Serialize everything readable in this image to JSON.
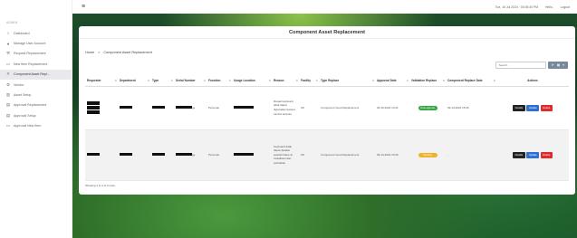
{
  "sidebar": {
    "header": "ADMIN",
    "items": [
      {
        "label": "Dashboard",
        "icon": "home-icon"
      },
      {
        "label": "Manage User Account",
        "icon": "user-icon"
      },
      {
        "label": "Request Replacement",
        "icon": "wrench-icon"
      },
      {
        "label": "New Item Replacement",
        "icon": "document-icon"
      },
      {
        "label": "Component Asset Repl...",
        "icon": "cross-arrows-icon"
      },
      {
        "label": "Vendor",
        "icon": "gear-icon"
      },
      {
        "label": "Asset Setup",
        "icon": "trash-icon"
      },
      {
        "label": "Approval Replacement",
        "icon": "calendar-icon"
      },
      {
        "label": "Approval Setup",
        "icon": "calendar-icon"
      },
      {
        "label": "Approval New Item",
        "icon": "document-icon"
      }
    ]
  },
  "topbar": {
    "datetime": "Tue, 16 Jul 2024 · 03:05:40 PM",
    "link1": "Hello,",
    "link2": "Logout"
  },
  "card": {
    "title": "Component Asset Replacement"
  },
  "breadcrumb": {
    "home": "Home",
    "separator": ">",
    "current": "Component Asset Replacement"
  },
  "toolbar": {
    "search_placeholder": "Search",
    "refresh_label": "⟳",
    "view_label": "▦",
    "more_label": "▾"
  },
  "table": {
    "columns": [
      "Requester",
      "Department",
      "Type",
      "Serial Number",
      "Function",
      "Usage Location",
      "Reason",
      "Facility",
      "Type Replace",
      "Approval Date",
      "Validation Replace",
      "Component Replace Date",
      "Actions"
    ],
    "rows": [
      {
        "serial_suffix": "04",
        "function": "Personal",
        "reason": "Rusak keyboard tidak dapat digunakan karena tombol tertentu",
        "facility": "OK",
        "type_replace": "Component Good Replacement",
        "approval_date": "09-16-2024 13:21",
        "validation": "Done approval",
        "validation_color": "#3aa64a",
        "component_replace_date": "09-14-2024 15:26",
        "actions": {
          "details": "Details",
          "update": "Update",
          "delete": "Delete"
        }
      },
      {
        "serial_suffix": "94",
        "function": "Personal",
        "reason": "Keyboard tidak dapat dipakai setelah fokus di inisialisasi dan perbaikan",
        "facility": "OK",
        "type_replace": "Component Good Replacement",
        "approval_date": "09-14-2024 15:26",
        "validation": "Pending",
        "validation_color": "#f0b429",
        "component_replace_date": "-",
        "actions": {
          "details": "Details",
          "update": "Update",
          "delete": "Delete"
        }
      }
    ]
  },
  "footer": {
    "showing": "Showing 1 to 2 of 2 rows"
  }
}
